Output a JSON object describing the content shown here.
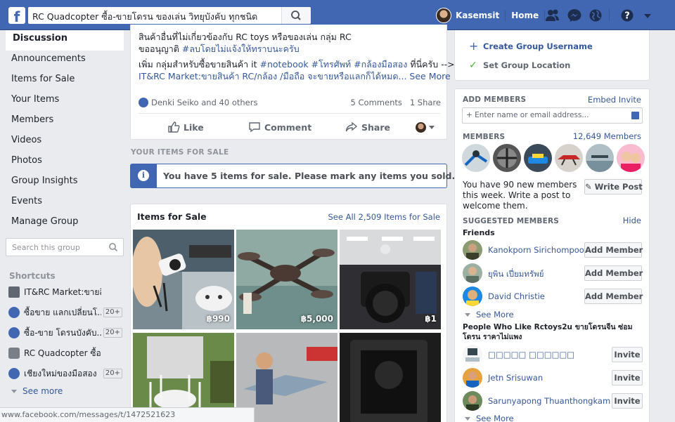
{
  "topbar": {
    "logo": "f",
    "search_value": "RC Quadcopter ซื้อ-ขายโดรน ของเล่น วิทยุบังคับ ทุกชนิด",
    "user_name": "Kasemsit",
    "home_label": "Home"
  },
  "leftnav": {
    "items": [
      "Discussion",
      "Announcements",
      "Items for Sale",
      "Your Items",
      "Members",
      "Videos",
      "Photos",
      "Group Insights",
      "Events",
      "Manage Group"
    ],
    "search_placeholder": "Search this group",
    "shortcuts_heading": "Shortcuts",
    "shortcuts": [
      {
        "label": "IT&RC Market:ขายสินค้า...",
        "badge": ""
      },
      {
        "label": "ซื้อขาย แลกเปลี่ยนโ...",
        "badge": "20+"
      },
      {
        "label": "ซื้อ-ขาย โดรนบังคับ...",
        "badge": "20+"
      },
      {
        "label": "RC Quadcopter ซื้อ-ขาย...",
        "badge": ""
      },
      {
        "label": "เชียงใหม่ของมือสอง",
        "badge": "20+"
      }
    ],
    "see_more": "See more"
  },
  "status_url": "www.facebook.com/messages/t/1472521623",
  "post": {
    "line1": "สินค้าอื่นที่ไม่เกี่ยวข้องกับ RC toys หรือของเล่น กลุ่ม RC",
    "line2_prefix": "ขออนุญาติ ",
    "line2_tag": "#ลบโดยไม่แจ้งให้ทราบนะครับ",
    "line3_prefix": "เพิ่ม กลุ่มสำหรับซื้อขายสินค้า it ",
    "line3_tags": "#notebook #โทรศัพท์ #กล้องมือสอง",
    "line3_suffix": " ที่นี่ครับ -->",
    "line4_link": "IT&RC Market:ขายสินค้า RC/กล้อง /มือถือ จะขายหรือแลกก็ได้หมด...",
    "see_more": "See More",
    "reactions": "Denki Seiko and 40 others",
    "comments": "5 Comments",
    "shares": "1 Share",
    "like": "Like",
    "comment": "Comment",
    "share": "Share"
  },
  "items_section": {
    "heading": "YOUR ITEMS FOR SALE",
    "notice": "You have 5 items for sale. Please mark any items you sold.",
    "title": "Items for Sale",
    "see_all": "See All 2,509 Items for Sale",
    "prices": [
      "฿990",
      "฿5,000",
      "฿1",
      "",
      "",
      ""
    ]
  },
  "right_top": {
    "create_username": "Create Group Username",
    "set_location": "Set Group Location"
  },
  "right_main": {
    "add_members_h": "ADD MEMBERS",
    "embed_invite": "Embed Invite",
    "add_placeholder": "+ Enter name or email address...",
    "members_h": "MEMBERS",
    "members_count": "12,649 Members",
    "new_members_text": "You have 90 new members this week. Write a post to welcome them.",
    "write_post": "Write Post",
    "suggested_h": "SUGGESTED MEMBERS",
    "hide": "Hide",
    "friends_label": "Friends",
    "friends": [
      {
        "name": "Kanokporn Sirichompoo",
        "action": "Add Member"
      },
      {
        "name": "ยุพิน เปี่ยมทรัพย์",
        "action": "Add Member"
      },
      {
        "name": "David Christie",
        "action": "Add Member"
      }
    ],
    "see_more": "See More",
    "people_like": "People Who Like Rctoys2u ขายโดรนจีน ซ่อมโดรน ราคาไม่แพง",
    "likers": [
      {
        "name": "□□□□□ □□□□□□",
        "action": "Invite"
      },
      {
        "name": "Jetn Srisuwan",
        "action": "Invite"
      },
      {
        "name": "Sarunyapong Thuanthongkam",
        "action": "Invite"
      }
    ],
    "see_more_2": "See More"
  },
  "colors": {
    "brand": "#4267b2",
    "link": "#365899",
    "bg": "#e9ebee"
  }
}
